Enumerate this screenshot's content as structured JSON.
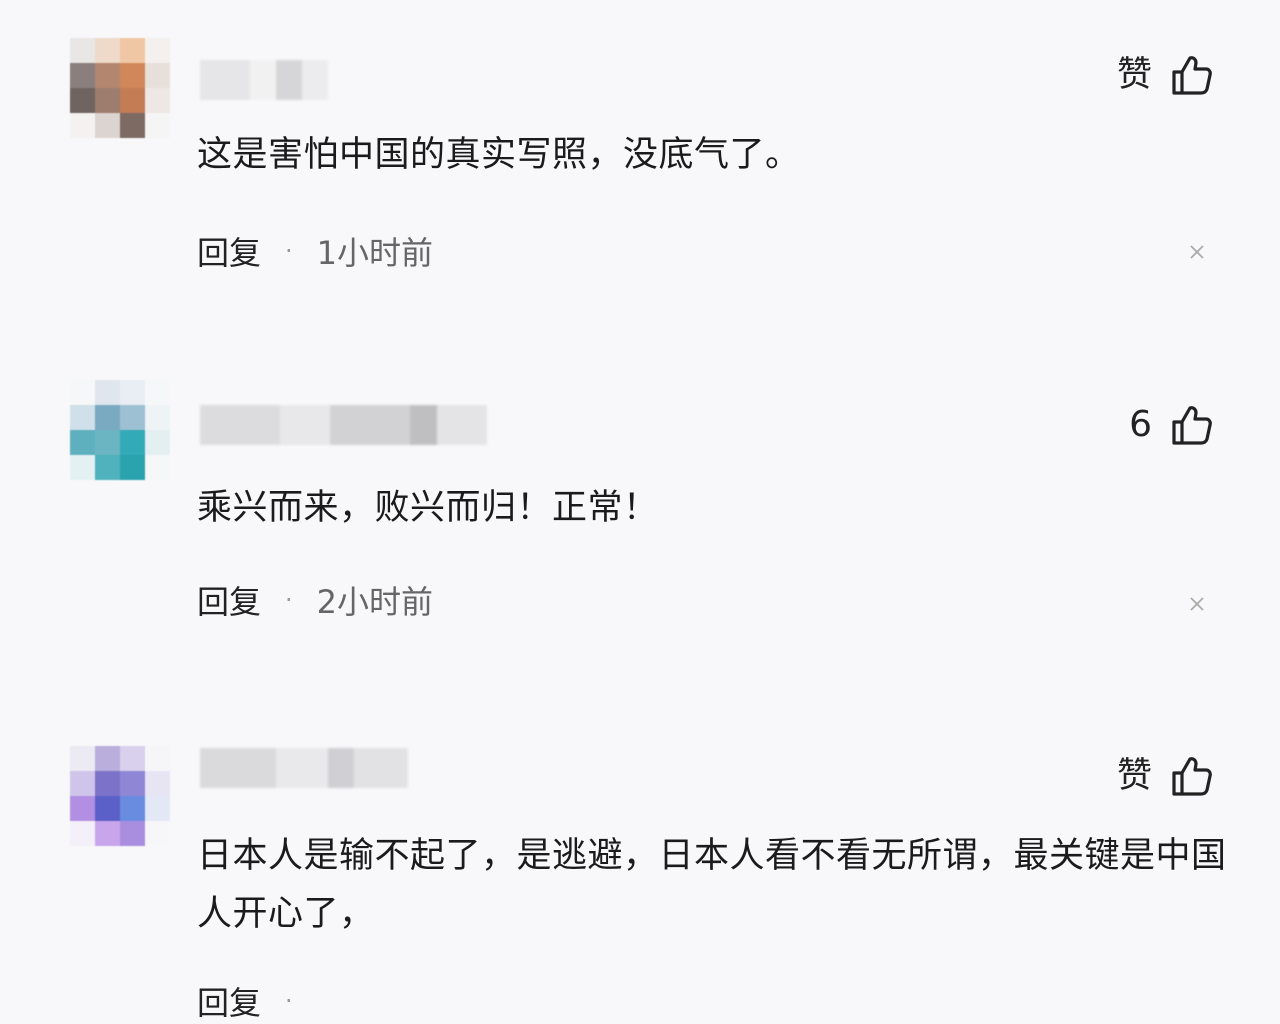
{
  "comments": [
    {
      "like_label": "赞",
      "text": "这是害怕中国的真实写照，没底气了。",
      "reply_label": "回复",
      "separator": "·",
      "time": "1小时前"
    },
    {
      "like_label": "6",
      "text": "乘兴而来，败兴而归！正常！",
      "reply_label": "回复",
      "separator": "·",
      "time": "2小时前"
    },
    {
      "like_label": "赞",
      "text": "日本人是输不起了，是逃避，日本人看不看无所谓，最关键是中国人开心了，",
      "reply_label": "回复",
      "separator": "·",
      "time": ""
    }
  ],
  "icons": {
    "like": "thumbs-up-icon",
    "close": "close-icon"
  },
  "colors": {
    "background": "#f8f8fa",
    "text": "#1b1b1d",
    "muted": "#666666"
  }
}
